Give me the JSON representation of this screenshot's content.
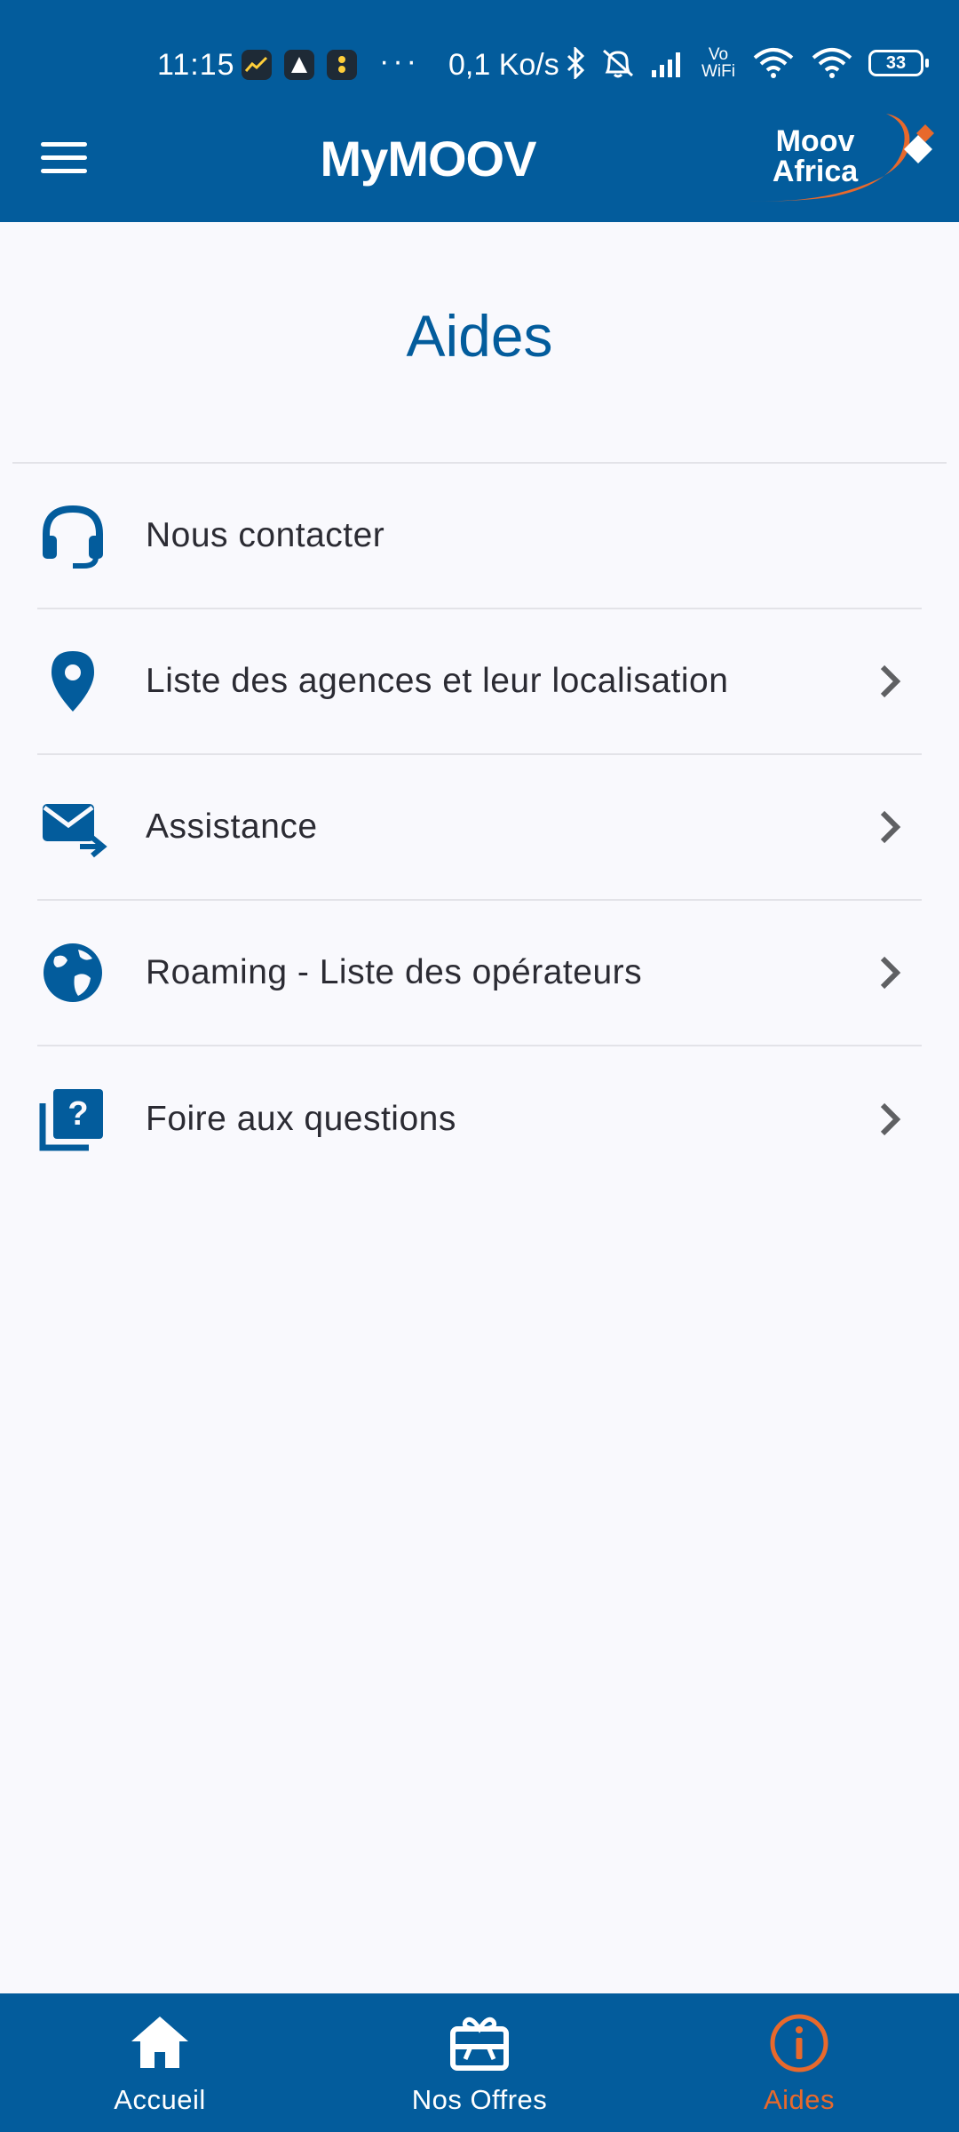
{
  "status_bar": {
    "time": "11:15",
    "more": "···",
    "speed": "0,1 Ko/s",
    "vowifi": "Vo WiFi",
    "battery": "33"
  },
  "app_bar": {
    "title": "MyMOOV",
    "logo_line1": "Moov",
    "logo_line2": "Africa"
  },
  "page": {
    "title": "Aides"
  },
  "list": {
    "items": [
      {
        "label": "Nous contacter",
        "icon": "headset-icon"
      },
      {
        "label": "Liste des agences et leur localisation",
        "icon": "location-pin-icon"
      },
      {
        "label": "Assistance",
        "icon": "mail-forward-icon"
      },
      {
        "label": "Roaming - Liste des opérateurs",
        "icon": "globe-icon"
      },
      {
        "label": "Foire aux questions",
        "icon": "faq-icon"
      }
    ]
  },
  "bottom_nav": {
    "items": [
      {
        "label": "Accueil",
        "icon": "home-icon",
        "active": false
      },
      {
        "label": "Nos Offres",
        "icon": "gift-card-icon",
        "active": false
      },
      {
        "label": "Aides",
        "icon": "info-icon",
        "active": true
      }
    ]
  },
  "colors": {
    "primary": "#035c9c",
    "accent": "#e8692c",
    "background": "#f9f9fd"
  }
}
